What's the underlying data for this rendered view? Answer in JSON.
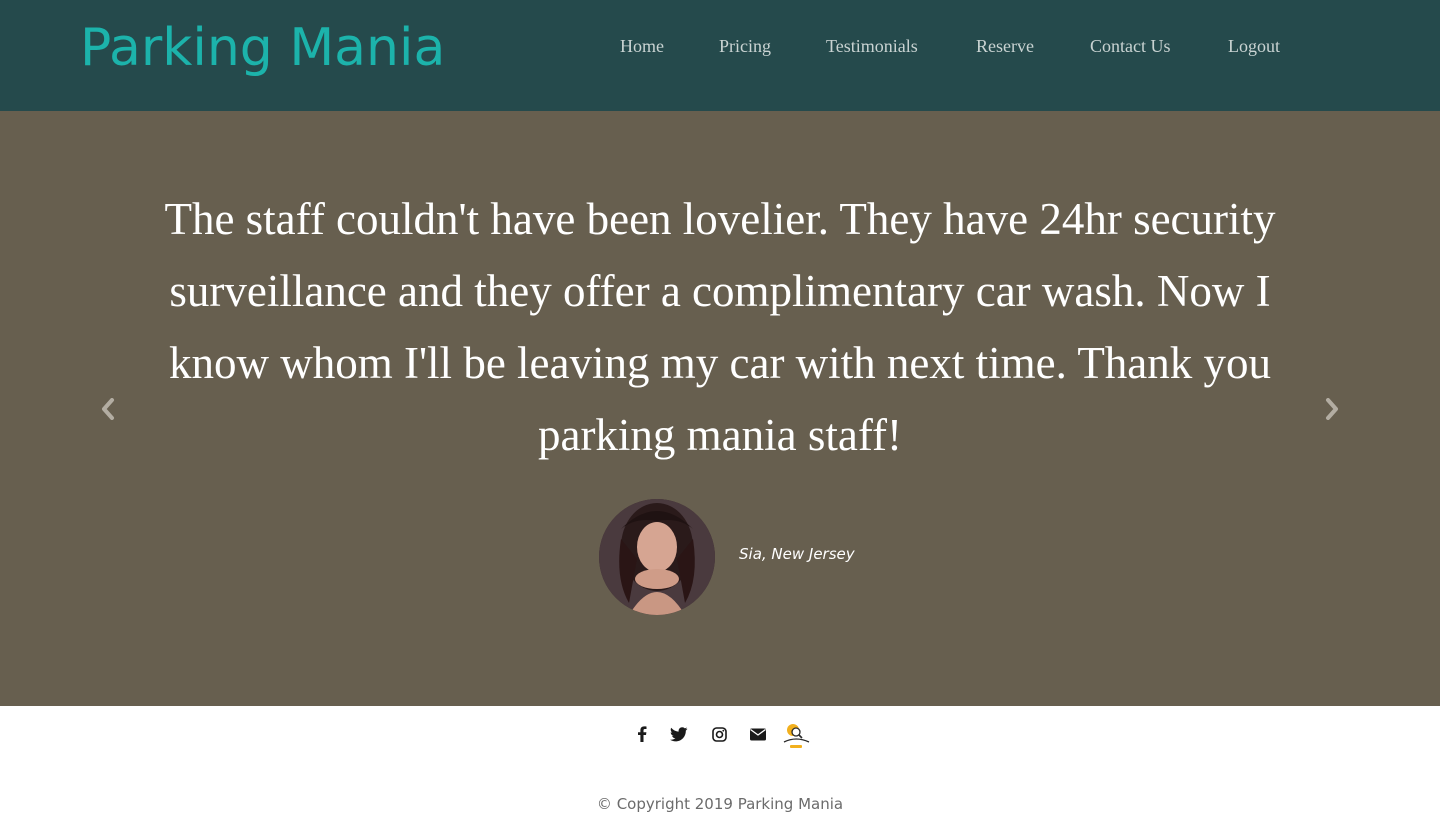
{
  "header": {
    "brand": "Parking Mania",
    "nav": [
      "Home",
      "Pricing",
      "Testimonials",
      "Reserve",
      "Contact Us",
      "Logout"
    ]
  },
  "testimonial": {
    "quote": "The staff couldn't have been lovelier. They have 24hr security surveillance and they offer a complimentary car wash. Now I know whom I'll be leaving my car with next time. Thank you parking mania staff!",
    "author": "Sia, New Jersey",
    "prev_icon": "chevron-left-icon",
    "next_icon": "chevron-right-icon"
  },
  "footer": {
    "social_icons": [
      "facebook-icon",
      "twitter-icon",
      "instagram-icon",
      "envelope-icon",
      "parking-mania-logo"
    ],
    "copyright": "© Copyright 2019 Parking Mania"
  },
  "colors": {
    "navbar_bg": "#254a4c",
    "brand": "#1cb3ab",
    "hero_bg": "#675f4f",
    "nav_link": "#c9d3d2"
  }
}
